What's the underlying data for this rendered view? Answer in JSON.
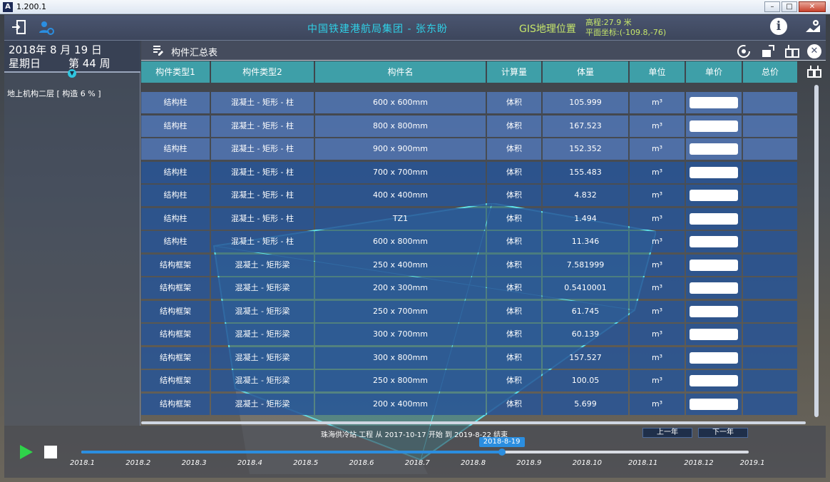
{
  "window": {
    "title": "1.200.1",
    "app_icon": "A"
  },
  "header": {
    "title": "中国铁建港航局集团 - 张东盼",
    "gis_label": "GIS地理位置",
    "elevation": "高程:27.9 米",
    "plane_coords": "平面坐标:(-109.8,-76)",
    "info_glyph": "i"
  },
  "left": {
    "date_line": "2018年 8 月 19 日",
    "weekday": "星期日",
    "week": "第 44 周",
    "progress_label": "地上机构二层 [ 构造 6 % ]"
  },
  "panel": {
    "title": "构件汇总表",
    "columns": [
      "构件类型1",
      "构件类型2",
      "构件名",
      "计算量",
      "体量",
      "单位",
      "单价",
      "总价"
    ],
    "rows": [
      {
        "t1": "结构柱",
        "t2": "混凝土 - 矩形 - 柱",
        "name": "600 x 600mm",
        "calc": "体积",
        "qty": "105.999",
        "unit": "m³"
      },
      {
        "t1": "结构柱",
        "t2": "混凝土 - 矩形 - 柱",
        "name": "800 x 800mm",
        "calc": "体积",
        "qty": "167.523",
        "unit": "m³"
      },
      {
        "t1": "结构柱",
        "t2": "混凝土 - 矩形 - 柱",
        "name": "900 x 900mm",
        "calc": "体积",
        "qty": "152.352",
        "unit": "m³"
      },
      {
        "t1": "结构柱",
        "t2": "混凝土 - 矩形 - 柱",
        "name": "700 x 700mm",
        "calc": "体积",
        "qty": "155.483",
        "unit": "m³"
      },
      {
        "t1": "结构柱",
        "t2": "混凝土 - 矩形 - 柱",
        "name": "400 x 400mm",
        "calc": "体积",
        "qty": "4.832",
        "unit": "m³"
      },
      {
        "t1": "结构柱",
        "t2": "混凝土 - 矩形 - 柱",
        "name": "TZ1",
        "calc": "体积",
        "qty": "1.494",
        "unit": "m³"
      },
      {
        "t1": "结构柱",
        "t2": "混凝土 - 矩形 - 柱",
        "name": "600 x 800mm",
        "calc": "体积",
        "qty": "11.346",
        "unit": "m³"
      },
      {
        "t1": "结构框架",
        "t2": "混凝土 - 矩形梁",
        "name": "250 x 400mm",
        "calc": "体积",
        "qty": "7.581999",
        "unit": "m³"
      },
      {
        "t1": "结构框架",
        "t2": "混凝土 - 矩形梁",
        "name": "200 x 300mm",
        "calc": "体积",
        "qty": "0.5410001",
        "unit": "m³"
      },
      {
        "t1": "结构框架",
        "t2": "混凝土 - 矩形梁",
        "name": "250 x 700mm",
        "calc": "体积",
        "qty": "61.745",
        "unit": "m³"
      },
      {
        "t1": "结构框架",
        "t2": "混凝土 - 矩形梁",
        "name": "300 x 700mm",
        "calc": "体积",
        "qty": "60.139",
        "unit": "m³"
      },
      {
        "t1": "结构框架",
        "t2": "混凝土 - 矩形梁",
        "name": "300 x 800mm",
        "calc": "体积",
        "qty": "157.527",
        "unit": "m³"
      },
      {
        "t1": "结构框架",
        "t2": "混凝土 - 矩形梁",
        "name": "250 x 800mm",
        "calc": "体积",
        "qty": "100.05",
        "unit": "m³"
      },
      {
        "t1": "结构框架",
        "t2": "混凝土 - 矩形梁",
        "name": "200 x 400mm",
        "calc": "体积",
        "qty": "5.699",
        "unit": "m³"
      }
    ]
  },
  "timeline": {
    "project_text": "珠海供冷站 工程 从 2017-10-17 开始 到 2019-8-22 结束",
    "prev_year": "上一年",
    "next_year": "下一年",
    "current_date": "2018-8-19",
    "progress_fraction": 0.63,
    "ticks": [
      "2018.1",
      "2018.2",
      "2018.3",
      "2018.4",
      "2018.5",
      "2018.6",
      "2018.7",
      "2018.8",
      "2018.9",
      "2018.10",
      "2018.11",
      "2018.12",
      "2019.1"
    ]
  },
  "colors": {
    "accent": "#2fd0e6",
    "gis": "#c6e66a",
    "table_header": "#3e9fa8",
    "cell": "#28559a",
    "play": "#2fd34a",
    "timeline": "#2b8ee0"
  }
}
